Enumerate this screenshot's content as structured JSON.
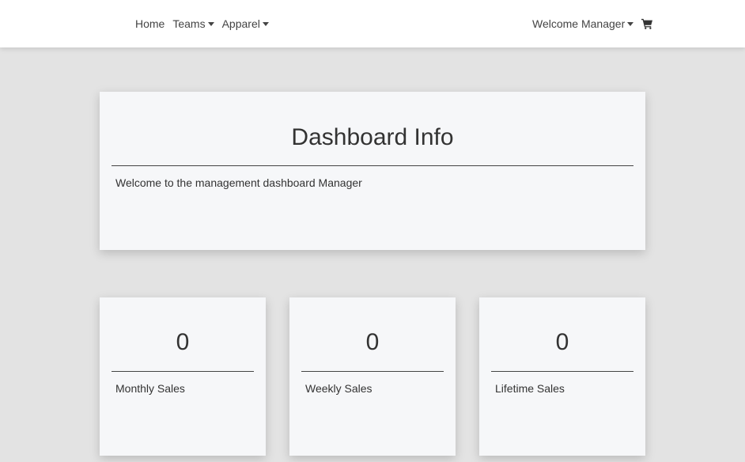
{
  "nav": {
    "home": "Home",
    "teams": "Teams",
    "apparel": "Apparel",
    "welcome": "Welcome Manager",
    "cart_icon": "shopping-cart-icon"
  },
  "dashboard": {
    "title": "Dashboard Info",
    "message": "Welcome to the management dashboard Manager"
  },
  "stats": [
    {
      "value": "0",
      "label": "Monthly Sales"
    },
    {
      "value": "0",
      "label": "Weekly Sales"
    },
    {
      "value": "0",
      "label": "Lifetime Sales"
    }
  ],
  "colors": {
    "page_bg": "#e3e3e3",
    "card_bg": "#f6f7f9",
    "text": "#333333"
  }
}
